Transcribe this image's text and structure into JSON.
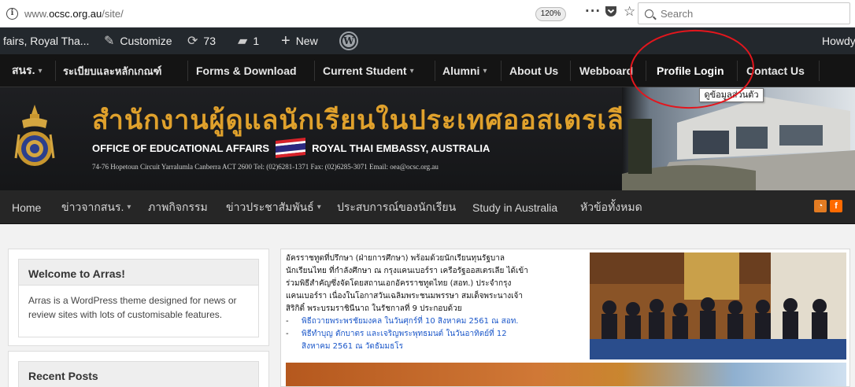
{
  "browser": {
    "url_prefix": "www.",
    "url_domain": "ocsc.org.au",
    "url_path": "/site/",
    "zoom": "120%",
    "menu_dots": "···",
    "search_placeholder": "Search",
    "icons": [
      "info-icon",
      "more-icon",
      "pocket-icon",
      "bookmark-star-icon",
      "search-icon"
    ]
  },
  "admin_bar": {
    "site_name": "fairs, Royal Tha...",
    "customize": "Customize",
    "updates_count": "73",
    "comments_count": "1",
    "new_label": "New",
    "howdy": "Howdy"
  },
  "top_nav": {
    "items": [
      {
        "label": "สนร.",
        "caret": true
      },
      {
        "label": "ระเบียบและหลักเกณฑ์",
        "caret": false
      },
      {
        "label": "Forms & Download",
        "caret": false
      },
      {
        "label": "Current Student",
        "caret": true
      },
      {
        "label": "Alumni",
        "caret": true
      },
      {
        "label": "About Us",
        "caret": false
      },
      {
        "label": "Webboard",
        "caret": false
      },
      {
        "label": "Profile Login",
        "caret": false
      },
      {
        "label": "Contact Us",
        "caret": false
      }
    ],
    "caret_char": "▾",
    "tooltip": "ดูข้อมูลส่วนตัว"
  },
  "banner": {
    "thai_title": "สำนักงานผู้ดูแลนักเรียนในประเทศออสเตรเลีย",
    "english_left": "OFFICE OF EDUCATIONAL AFFAIRS",
    "english_right": "ROYAL THAI EMBASSY, AUSTRALIA",
    "address": "74-76 Hopetoun Circuit Yarralumla Canberra ACT 2600  Tel: (02)6281-1371  Fax: (02)6285-3071  Email: oea@ocsc.org.au",
    "flag_colors": [
      "#d8232a",
      "#ffffff",
      "#2b2a80",
      "#ffffff",
      "#d8232a"
    ]
  },
  "main_nav": {
    "items": [
      {
        "label": "Home",
        "caret": false
      },
      {
        "label": "ข่าวจากสนร.",
        "caret": true
      },
      {
        "label": "ภาพกิจกรรม",
        "caret": false
      },
      {
        "label": "ข่าวประชาสัมพันธ์",
        "caret": true
      },
      {
        "label": "ประสบการณ์ของนักเรียน",
        "caret": false
      },
      {
        "label": "Study in Australia",
        "caret": false
      },
      {
        "label": "หัวข้อทั้งหมด",
        "caret": false
      }
    ],
    "caret_char": "▾",
    "rss_glyph": "◔",
    "facebook_glyph": "f"
  },
  "sidebar": {
    "welcome_title": "Welcome to Arras!",
    "welcome_text": "Arras is a WordPress theme designed for news or review sites with lots of customisable features.",
    "recent_title": "Recent Posts"
  },
  "featured": {
    "lines": [
      "อัครราชทูตที่ปรึกษา (ฝ่ายการศึกษา) พร้อมด้วยนักเรียนทุนรัฐบาล",
      "นักเรียนไทย ที่กำลังศึกษา ณ กรุงแคนเบอร์รา เครือรัฐออสเตรเลีย ได้เข้า",
      "ร่วมพิธีสำคัญซึ่งจัดโดยสถานเอกอัครราชทูตไทย (สอท.) ประจำกรุง",
      "แคนเบอร์รา เนื่องในโอกาสวันเฉลิมพระชนมพรรษา สมเด็จพระนางเจ้า",
      "สิริกิติ์ พระบรมราชินีนาถ ในรัชกาลที่ 9 ประกอบด้วย"
    ],
    "bullets": [
      "พิธีถวายพระพรชัยมงคล ในวันศุกร์ที่ 10 สิงหาคม 2561 ณ สอท.",
      "พิธีทำบุญ ตักบาตร และเจริญพระพุทธมนต์ ในวันอาทิตย์ที่ 12",
      "สิงหาคม 2561 ณ วัดธัมมธโร"
    ],
    "bullet_dash": "-"
  }
}
